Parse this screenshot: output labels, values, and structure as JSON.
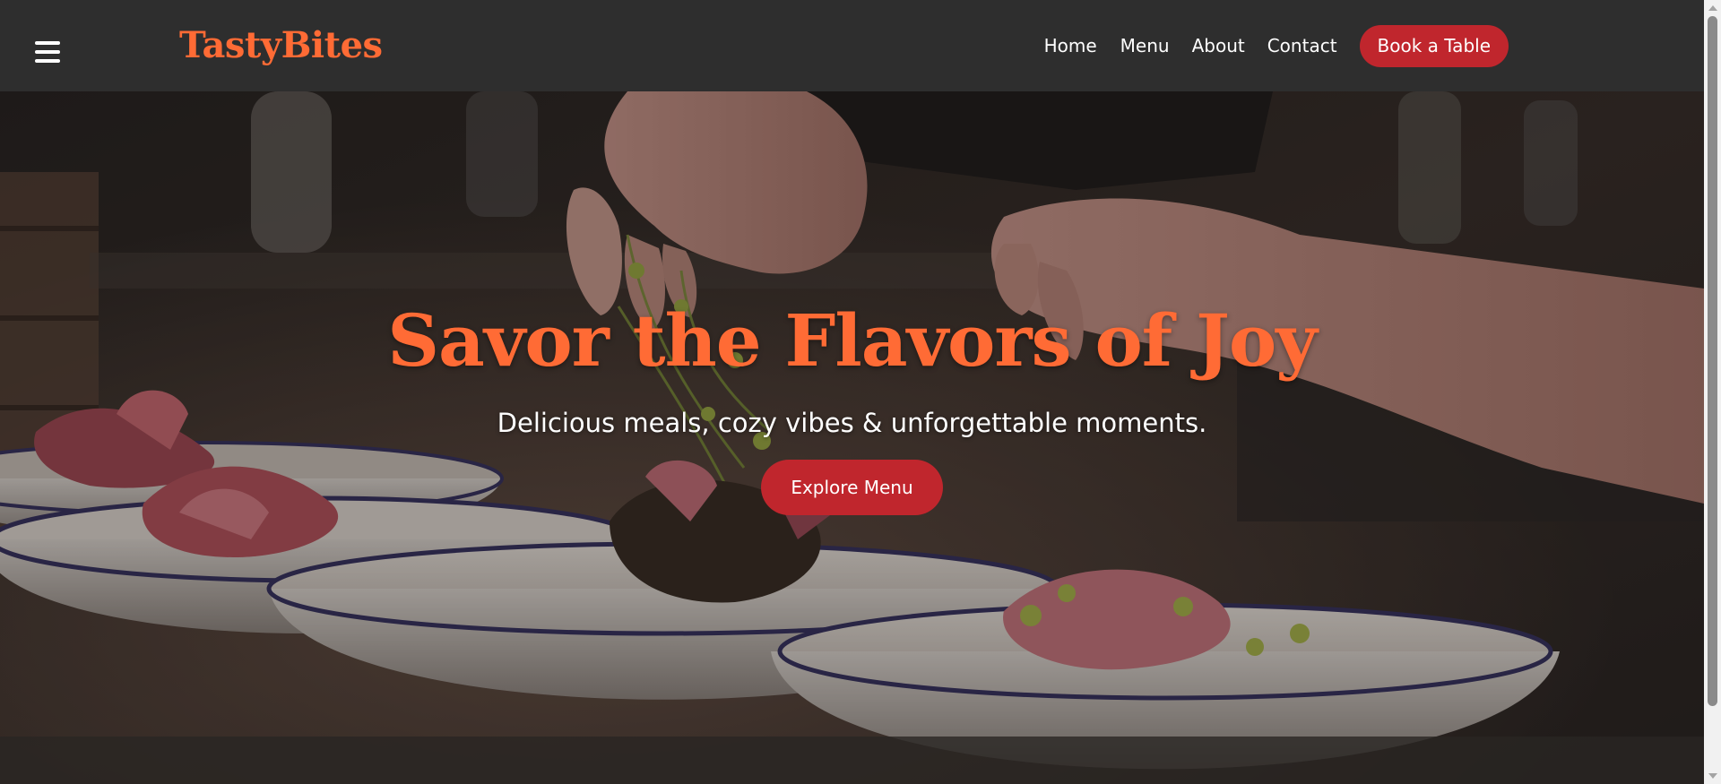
{
  "header": {
    "logo": "TastyBites",
    "nav": {
      "home": "Home",
      "menu": "Menu",
      "about": "About",
      "contact": "Contact"
    },
    "cta_label": "Book a Table"
  },
  "hero": {
    "title": "Savor the Flavors of Joy",
    "subtitle": "Delicious meals, cozy vibes & unforgettable moments.",
    "button_label": "Explore Menu"
  },
  "icons": {
    "menu_toggle": "hamburger-icon"
  },
  "colors": {
    "accent": "#ff6b35",
    "button": "#c0262d",
    "header_bg": "#2e2e2e"
  }
}
